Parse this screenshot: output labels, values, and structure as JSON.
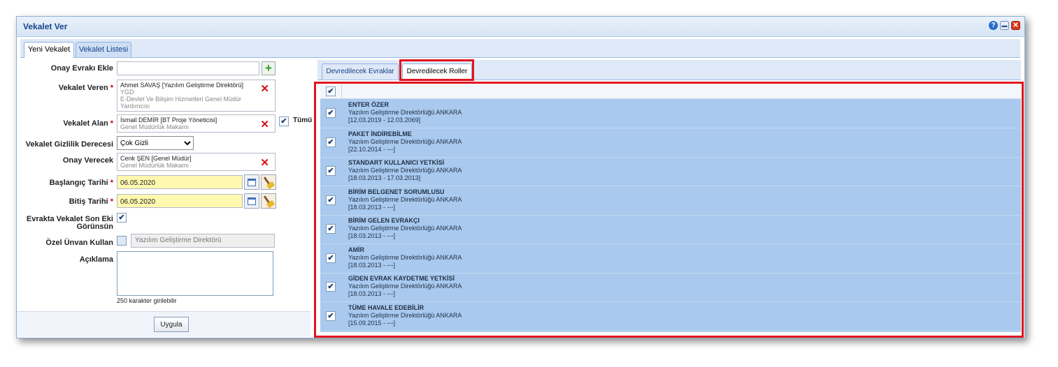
{
  "window": {
    "title": "Vekalet Ver"
  },
  "main_tabs": [
    "Yeni Vekalet",
    "Vekalet Listesi"
  ],
  "form": {
    "onay_evraki_label": "Onay Evrakı Ekle",
    "veren_label": "Vekalet Veren",
    "veren_name": "Ahmet SAVAŞ [Yazılım Geliştirme Direktörü]",
    "veren_sub1": "YGD",
    "veren_sub2": "E-Devlet Ve Bilişim Hizmetleri Genel Müdür",
    "veren_sub3": "Yardımcısı",
    "alan_label": "Vekalet Alan",
    "alan_name": "İsmail DEMİR [BT Proje Yöneticisi]",
    "alan_sub": "Genel Müdürlük Makamı",
    "tumu_label": "Tümü",
    "gizlilik_label": "Vekalet Gizlilik Derecesi",
    "gizlilik_value": "Çok Gizli",
    "onay_verecek_label": "Onay Verecek",
    "onay_verecek_name": "Cenk ŞEN [Genel Müdür]",
    "onay_verecek_sub": "Genel Müdürlük Makamı",
    "baslangic_label": "Başlangıç Tarihi",
    "baslangic_value": "06.05.2020",
    "bitis_label": "Bitiş Tarihi",
    "bitis_value": "06.05.2020",
    "son_ek_label_1": "Evrakta Vekalet Son Eki",
    "son_ek_label_2": "Görünsün",
    "ozel_unvan_label": "Özel Ünvan Kullan",
    "ozel_unvan_placeholder": "Yazılım Geliştirme Direktörü",
    "aciklama_label": "Açıklama",
    "char_counter": "250 karakter girilebilir",
    "apply_label": "Uygula",
    "required_mark": "*"
  },
  "right_tabs": [
    "Devredilecek Evraklar",
    "Devredilecek Roller"
  ],
  "roles": [
    {
      "name": "ENTER ÖZER",
      "dept": "Yazılım Geliştirme Direktörlüğü ANKARA",
      "dates": "[12.03.2019 - 12.03.2069]"
    },
    {
      "name": "PAKET İNDİREBİLME",
      "dept": "Yazılım Geliştirme Direktörlüğü ANKARA",
      "dates": "[22.10.2014 - ---]"
    },
    {
      "name": "STANDART KULLANICI YETKİSİ",
      "dept": "Yazılım Geliştirme Direktörlüğü ANKARA",
      "dates": "[18.03.2013 - 17.03.2013]"
    },
    {
      "name": "BİRİM BELGENET SORUMLUSU",
      "dept": "Yazılım Geliştirme Direktörlüğü ANKARA",
      "dates": "[18.03.2013 - ---]"
    },
    {
      "name": "BİRİM GELEN EVRAKÇI",
      "dept": "Yazılım Geliştirme Direktörlüğü ANKARA",
      "dates": "[18.03.2013 - ---]"
    },
    {
      "name": "AMİR",
      "dept": "Yazılım Geliştirme Direktörlüğü ANKARA",
      "dates": "[18.03.2013 - ---]"
    },
    {
      "name": "GİDEN EVRAK KAYDETME YETKİSİ",
      "dept": "Yazılım Geliştirme Direktörlüğü ANKARA",
      "dates": "[18.03.2013 - ---]"
    },
    {
      "name": "TÜME HAVALE EDEBİLİR",
      "dept": "Yazılım Geliştirme Direktörlüğü ANKARA",
      "dates": "[15.09.2015 - ---]"
    }
  ],
  "icons": {
    "help": "help-icon",
    "minimize": "minimize-icon",
    "close": "close-icon",
    "add": "plus-icon",
    "remove": "remove-x-icon",
    "calendar": "calendar-icon",
    "clear": "broom-icon",
    "check": "checkmark"
  },
  "colors": {
    "title": "#15428b",
    "required": "#cc0000",
    "remove": "#d01414",
    "grid_bg": "#a9c9ee",
    "highlight": "#e0141f"
  }
}
